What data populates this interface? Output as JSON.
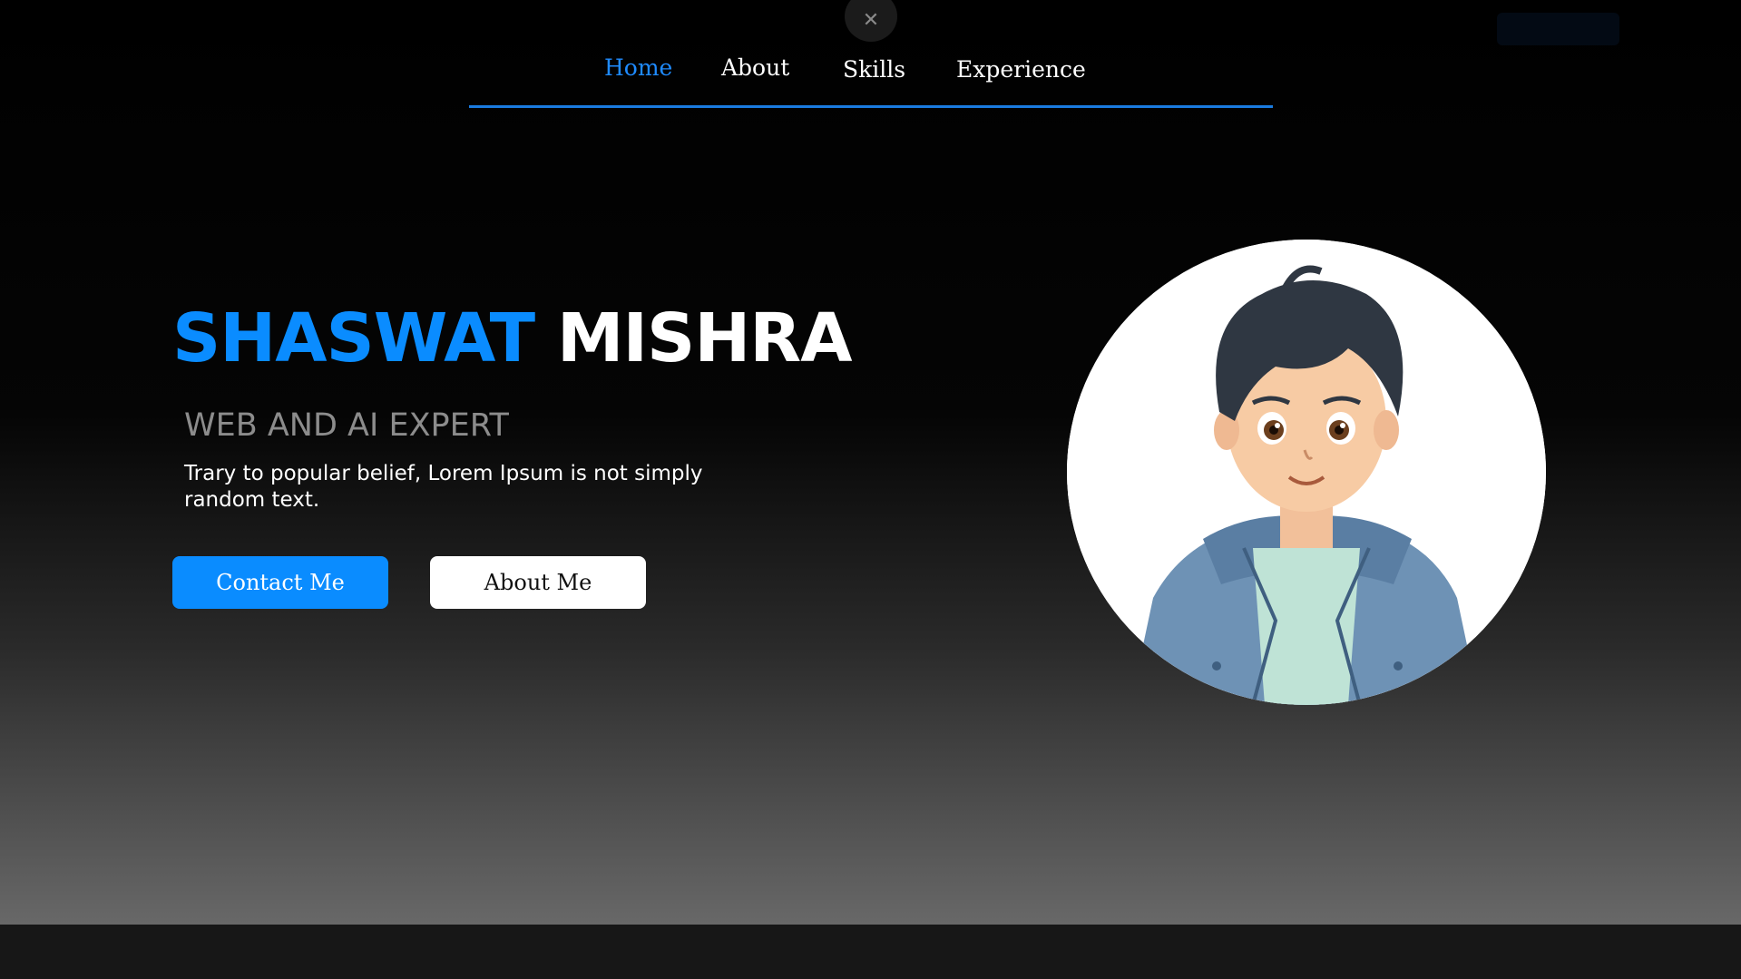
{
  "nav": {
    "items": [
      {
        "label": "Home",
        "active": true
      },
      {
        "label": "About",
        "active": false
      },
      {
        "label": "Skills",
        "active": false
      },
      {
        "label": "Experience",
        "active": false
      }
    ],
    "close_icon": "close-icon",
    "accent": "#1a7be0"
  },
  "hero": {
    "first_name": "SHASWAT",
    "last_name": "MISHRA",
    "subtitle": "WEB AND AI EXPERT",
    "description": "Trary to popular belief, Lorem Ipsum is not simply random text.",
    "buttons": {
      "contact": "Contact Me",
      "about": "About Me"
    },
    "avatar_alt": "avatar",
    "colors": {
      "primary": "#0a8cff",
      "subtitle": "#8c8c8c"
    }
  }
}
